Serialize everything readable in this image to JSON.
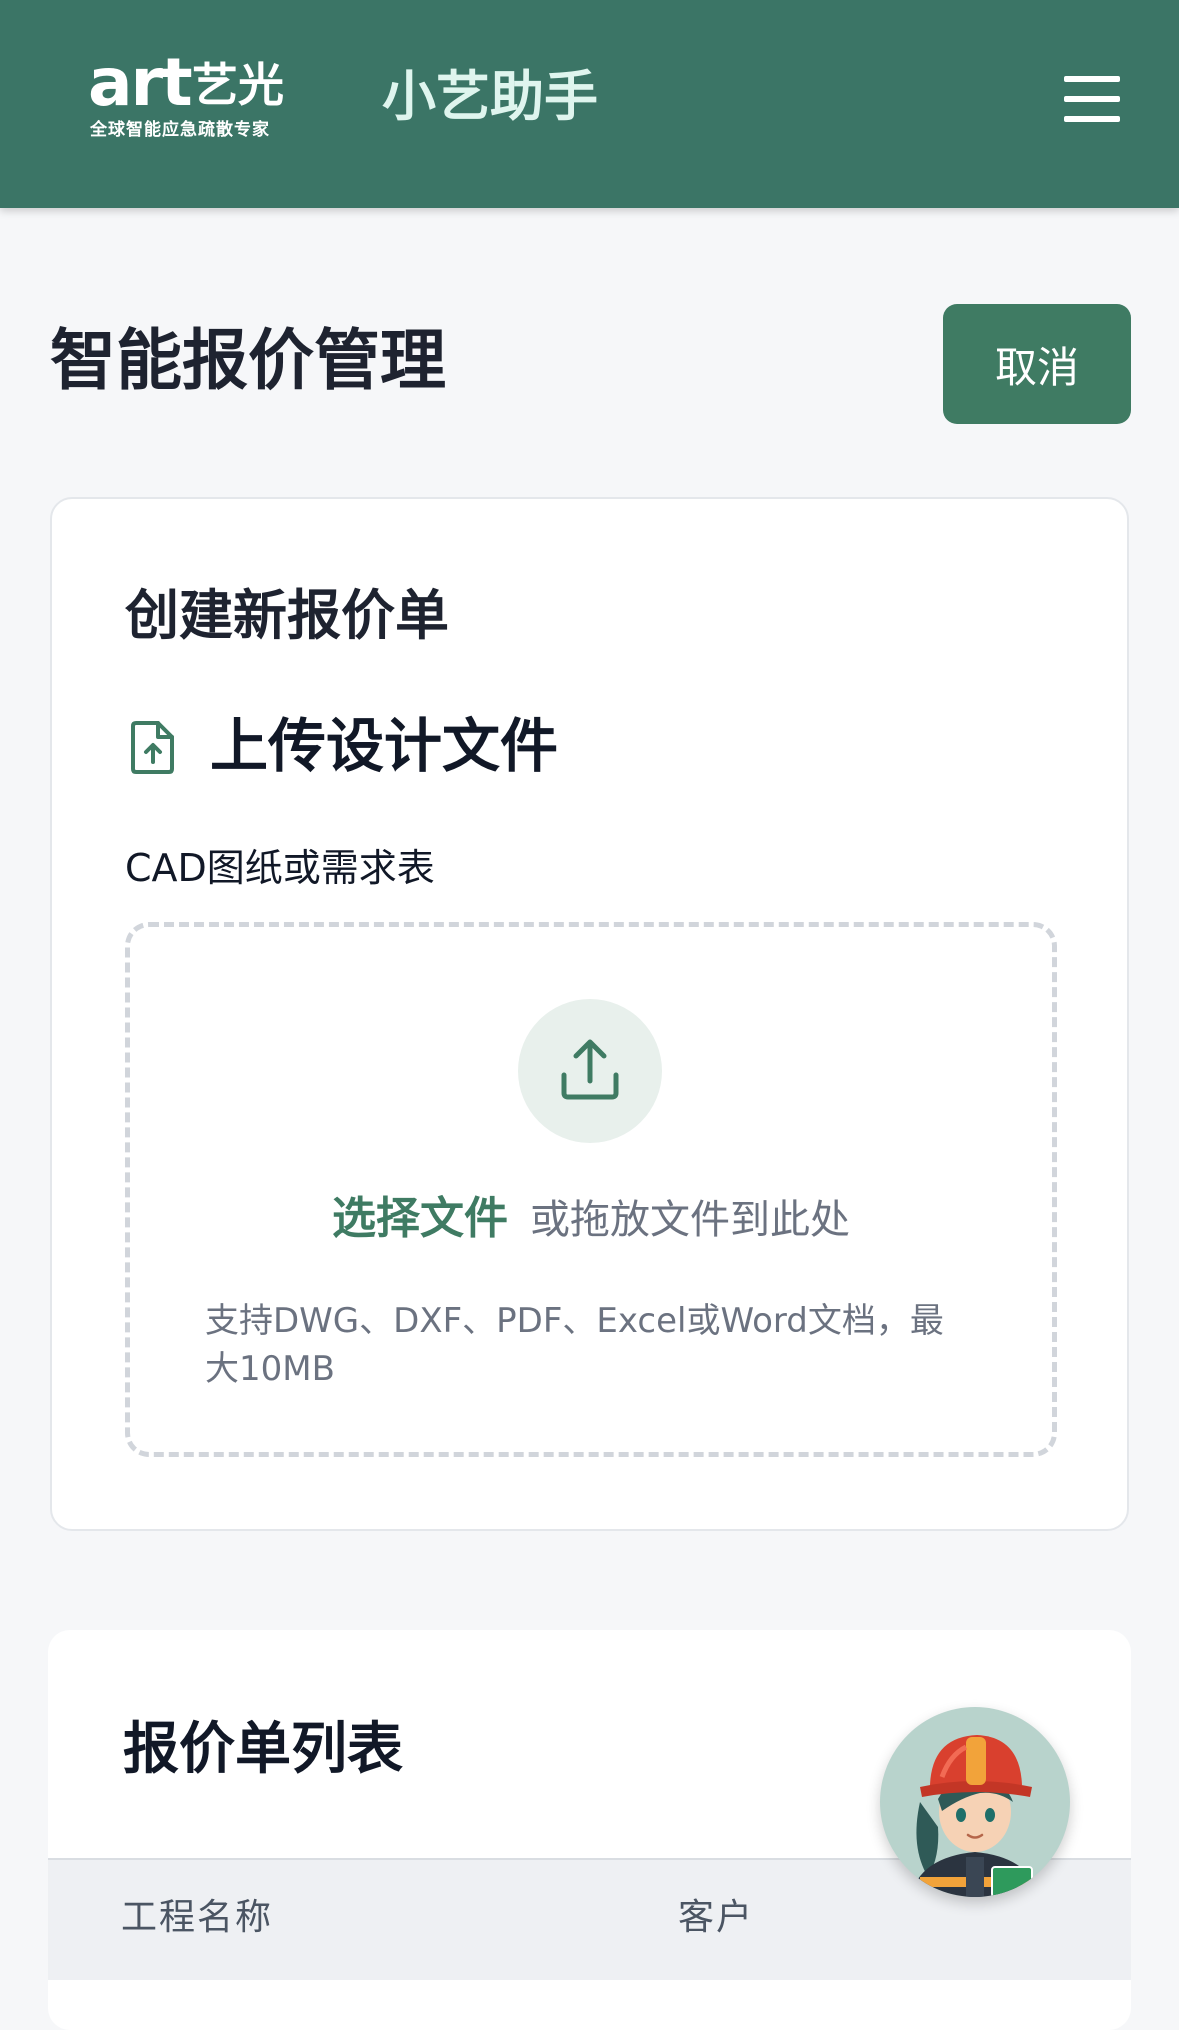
{
  "header": {
    "logo": {
      "main": "art",
      "cn": "艺光",
      "sub": "全球智能应急疏散专家"
    },
    "app_title": "小艺助手",
    "menu_icon": "hamburger-menu-icon"
  },
  "page": {
    "title": "智能报价管理",
    "cancel_label": "取消"
  },
  "create_card": {
    "title": "创建新报价单",
    "section_icon": "file-upload-icon",
    "section_title": "上传设计文件",
    "field_label": "CAD图纸或需求表",
    "dropzone": {
      "icon": "upload-icon",
      "choose_label": "选择文件",
      "drag_text": "或拖放文件到此处",
      "hint": "支持DWG、DXF、PDF、Excel或Word文档，最大10MB"
    }
  },
  "list_card": {
    "title": "报价单列表",
    "columns": [
      "工程名称",
      "客户"
    ]
  },
  "assistant": {
    "icon": "assistant-avatar-icon"
  },
  "colors": {
    "primary": "#3b7566",
    "button": "#3f7b63",
    "background": "#f6f7f9"
  }
}
